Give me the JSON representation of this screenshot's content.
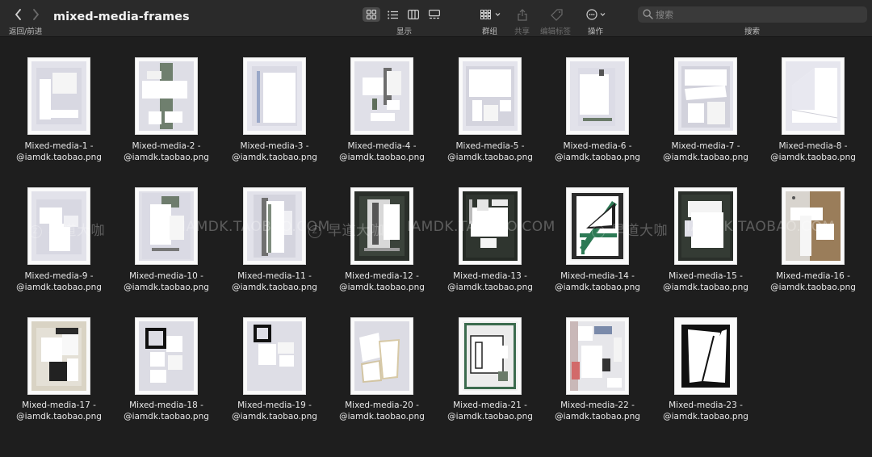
{
  "window": {
    "title": "mixed-media-frames",
    "nav_label": "返回/前进"
  },
  "toolbar": {
    "view_label": "显示",
    "group_label": "群组",
    "share_label": "共享",
    "tags_label": "编辑标签",
    "action_label": "操作",
    "search_label": "搜索",
    "search_placeholder": "搜索",
    "view_mode": "icon"
  },
  "watermark": {
    "brand": "早道大咖",
    "site": "IAMDK.TAOBAO.COM"
  },
  "files": [
    {
      "line1": "Mixed-media-1 -",
      "line2": "@iamdk.taobao.png"
    },
    {
      "line1": "Mixed-media-2 -",
      "line2": "@iamdk.taobao.png"
    },
    {
      "line1": "Mixed-media-3 -",
      "line2": "@iamdk.taobao.png"
    },
    {
      "line1": "Mixed-media-4 -",
      "line2": "@iamdk.taobao.png"
    },
    {
      "line1": "Mixed-media-5 -",
      "line2": "@iamdk.taobao.png"
    },
    {
      "line1": "Mixed-media-6 -",
      "line2": "@iamdk.taobao.png"
    },
    {
      "line1": "Mixed-media-7 -",
      "line2": "@iamdk.taobao.png"
    },
    {
      "line1": "Mixed-media-8 -",
      "line2": "@iamdk.taobao.png"
    },
    {
      "line1": "Mixed-media-9 -",
      "line2": "@iamdk.taobao.png"
    },
    {
      "line1": "Mixed-media-10 -",
      "line2": "@iamdk.taobao.png"
    },
    {
      "line1": "Mixed-media-11 -",
      "line2": "@iamdk.taobao.png"
    },
    {
      "line1": "Mixed-media-12 -",
      "line2": "@iamdk.taobao.png"
    },
    {
      "line1": "Mixed-media-13 -",
      "line2": "@iamdk.taobao.png"
    },
    {
      "line1": "Mixed-media-14 -",
      "line2": "@iamdk.taobao.png"
    },
    {
      "line1": "Mixed-media-15 -",
      "line2": "@iamdk.taobao.png"
    },
    {
      "line1": "Mixed-media-16 -",
      "line2": "@iamdk.taobao.png"
    },
    {
      "line1": "Mixed-media-17 -",
      "line2": "@iamdk.taobao.png"
    },
    {
      "line1": "Mixed-media-18 -",
      "line2": "@iamdk.taobao.png"
    },
    {
      "line1": "Mixed-media-19 -",
      "line2": "@iamdk.taobao.png"
    },
    {
      "line1": "Mixed-media-20 -",
      "line2": "@iamdk.taobao.png"
    },
    {
      "line1": "Mixed-media-21 -",
      "line2": "@iamdk.taobao.png"
    },
    {
      "line1": "Mixed-media-22 -",
      "line2": "@iamdk.taobao.png"
    },
    {
      "line1": "Mixed-media-23 -",
      "line2": "@iamdk.taobao.png"
    }
  ],
  "colors": {
    "background": "#1e1e1e",
    "toolbar": "#2a2a2a",
    "text": "#e8e8e8"
  }
}
